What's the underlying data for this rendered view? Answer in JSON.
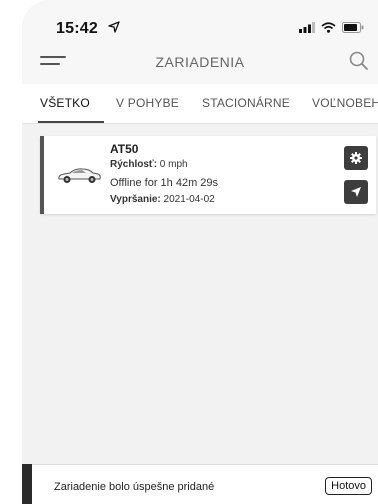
{
  "status_bar": {
    "time": "15:42"
  },
  "header": {
    "title": "ZARIADENIA"
  },
  "tabs": [
    {
      "label": "VŠETKO",
      "active": true
    },
    {
      "label": "V POHYBE",
      "active": false
    },
    {
      "label": "STACIONÁRNE",
      "active": false
    },
    {
      "label": "VOĽNOBEH",
      "active": false
    }
  ],
  "device": {
    "name": "AT50",
    "speed_label": "Rýchlosť:",
    "speed_value": " 0 mph",
    "status": "Offline for 1h 42m 29s",
    "expiry_label": "Vypršanie:",
    "expiry_value": " 2021-04-02",
    "accent_color": "#555555"
  },
  "toast": {
    "message": "Zariadenie bolo úspešne pridané",
    "button_label": "Hotovo"
  },
  "icons": [
    "location-arrow-icon",
    "signal-icon",
    "wifi-icon",
    "battery-icon",
    "menu-icon",
    "search-icon",
    "car-icon",
    "gear-icon",
    "navigate-icon"
  ]
}
